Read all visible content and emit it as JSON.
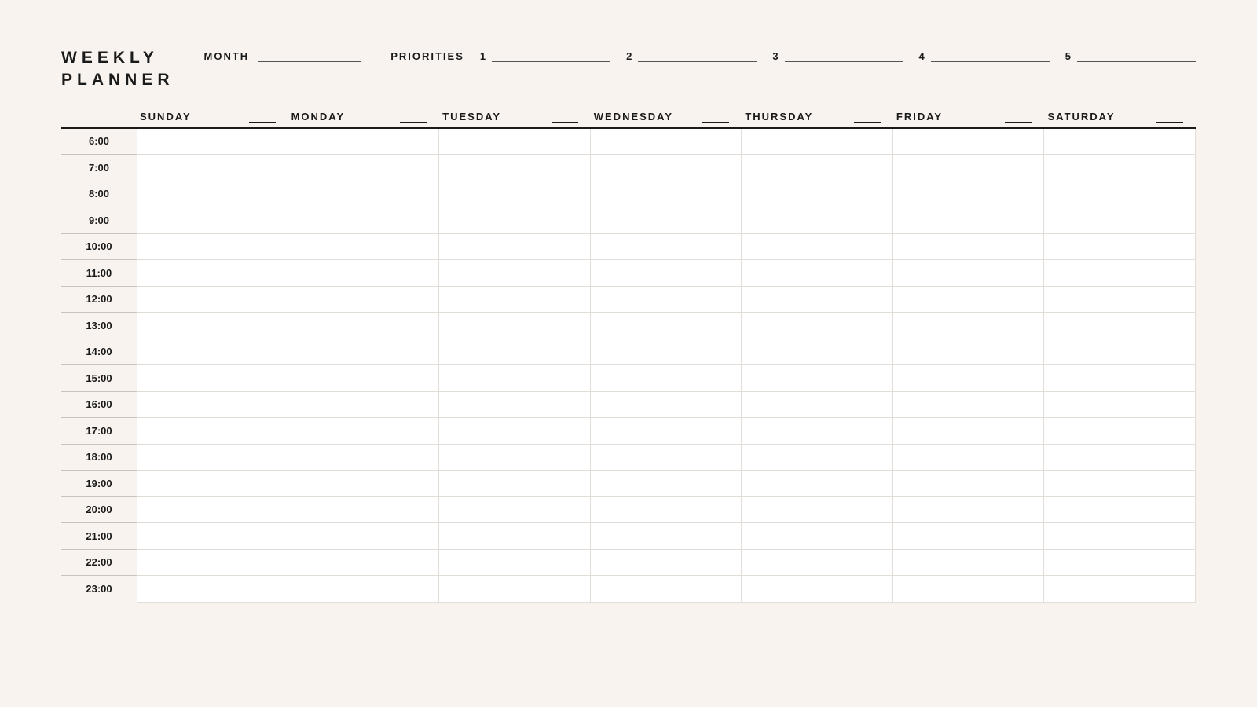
{
  "title": "WEEKLY\nPLANNER",
  "month_label": "MONTH",
  "priorities_label": "PRIORITIES",
  "priorities": [
    "1",
    "2",
    "3",
    "4",
    "5"
  ],
  "days": [
    "SUNDAY",
    "MONDAY",
    "TUESDAY",
    "WEDNESDAY",
    "THURSDAY",
    "FRIDAY",
    "SATURDAY"
  ],
  "times": [
    "6:00",
    "7:00",
    "8:00",
    "9:00",
    "10:00",
    "11:00",
    "12:00",
    "13:00",
    "14:00",
    "15:00",
    "16:00",
    "17:00",
    "18:00",
    "19:00",
    "20:00",
    "21:00",
    "22:00",
    "23:00"
  ]
}
